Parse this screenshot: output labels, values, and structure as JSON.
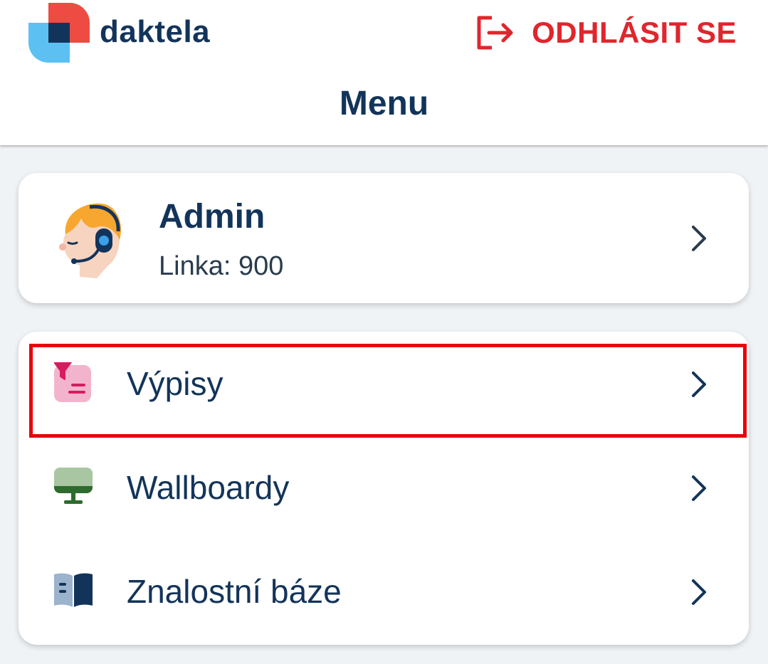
{
  "header": {
    "brand": "daktela",
    "logout_label": "ODHLÁSIT SE",
    "logout_icon": "logout-icon",
    "title": "Menu"
  },
  "profile": {
    "name": "Admin",
    "line": "Linka: 900",
    "avatar_icon": "agent-headset-avatar"
  },
  "menu": {
    "items": [
      {
        "label": "Výpisy",
        "icon": "filter-list-icon",
        "highlighted": true
      },
      {
        "label": "Wallboardy",
        "icon": "monitor-icon",
        "highlighted": false
      },
      {
        "label": "Znalostní báze",
        "icon": "book-icon",
        "highlighted": false
      }
    ]
  },
  "colors": {
    "brand": "#13345a",
    "accent_red": "#e0262d",
    "logo_red": "#ee4b43",
    "logo_blue": "#5cc0f2",
    "highlight": "#e8000b",
    "background": "#f0f3f6"
  }
}
